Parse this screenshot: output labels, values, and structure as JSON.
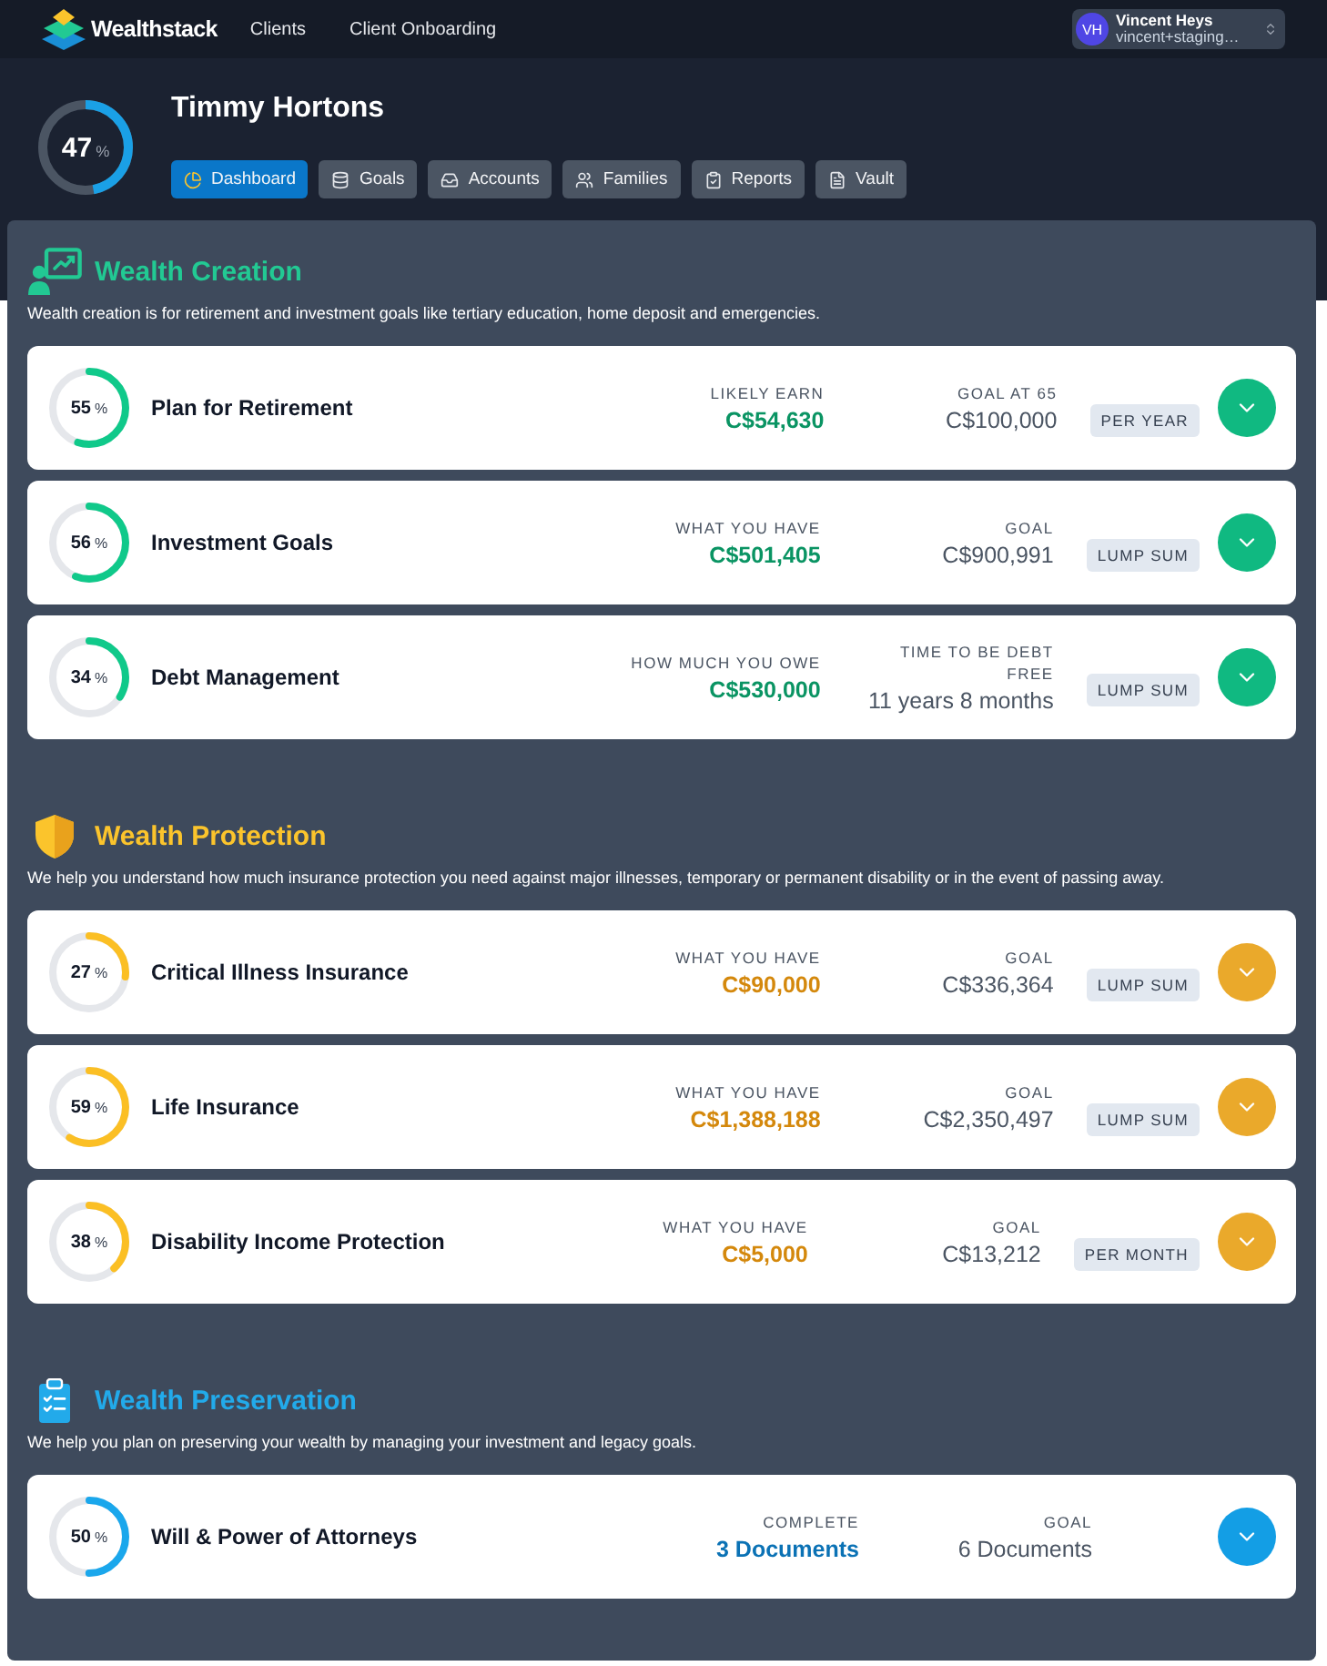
{
  "nav": {
    "brand": "Wealthstack",
    "links": [
      "Clients",
      "Client Onboarding"
    ],
    "user": {
      "initials": "VH",
      "name": "Vincent Heys",
      "email": "vincent+staging…"
    }
  },
  "client": {
    "name": "Timmy Hortons",
    "score": {
      "value": "47",
      "unit": "%",
      "level": 0.47
    }
  },
  "tabs": [
    {
      "label": "Dashboard",
      "selected": true
    },
    {
      "label": "Goals",
      "selected": false
    },
    {
      "label": "Accounts",
      "selected": false
    },
    {
      "label": "Families",
      "selected": false
    },
    {
      "label": "Reports",
      "selected": false
    },
    {
      "label": "Vault",
      "selected": false
    }
  ],
  "sections": [
    {
      "kind": "creation",
      "title": "Wealth Creation",
      "description": "Wealth creation is for retirement and investment goals like tertiary education, home deposit and emergencies.",
      "goals": [
        {
          "title": "Plan for Retirement",
          "progress": {
            "value": "55",
            "unit": "%",
            "level": 0.55
          },
          "current": {
            "label": "LIKELY EARN",
            "value": "C$54,630"
          },
          "target": {
            "label": "GOAL AT 65",
            "value": "C$100,000"
          },
          "badge": "PER YEAR"
        },
        {
          "title": "Investment Goals",
          "progress": {
            "value": "56",
            "unit": "%",
            "level": 0.56
          },
          "current": {
            "label": "WHAT YOU HAVE",
            "value": "C$501,405"
          },
          "target": {
            "label": "GOAL",
            "value": "C$900,991"
          },
          "badge": "LUMP SUM"
        },
        {
          "title": "Debt Management",
          "progress": {
            "value": "34",
            "unit": "%",
            "level": 0.34
          },
          "current": {
            "label": "HOW MUCH YOU OWE",
            "value": "C$530,000"
          },
          "target": {
            "label": "TIME TO BE DEBT FREE",
            "value": "11 years 8 months"
          },
          "badge": "LUMP SUM"
        }
      ]
    },
    {
      "kind": "protection",
      "title": "Wealth Protection",
      "description": "We help you understand how much insurance protection you need against major illnesses, temporary or permanent disability or in the event of passing away.",
      "goals": [
        {
          "title": "Critical Illness Insurance",
          "progress": {
            "value": "27",
            "unit": "%",
            "level": 0.27
          },
          "current": {
            "label": "WHAT YOU HAVE",
            "value": "C$90,000"
          },
          "target": {
            "label": "GOAL",
            "value": "C$336,364"
          },
          "badge": "LUMP SUM"
        },
        {
          "title": "Life Insurance",
          "progress": {
            "value": "59",
            "unit": "%",
            "level": 0.59
          },
          "current": {
            "label": "WHAT YOU HAVE",
            "value": "C$1,388,188"
          },
          "target": {
            "label": "GOAL",
            "value": "C$2,350,497"
          },
          "badge": "LUMP SUM"
        },
        {
          "title": "Disability Income Protection",
          "progress": {
            "value": "38",
            "unit": "%",
            "level": 0.38
          },
          "current": {
            "label": "WHAT YOU HAVE",
            "value": "C$5,000"
          },
          "target": {
            "label": "GOAL",
            "value": "C$13,212"
          },
          "badge": "PER MONTH"
        }
      ]
    },
    {
      "kind": "preservation",
      "title": "Wealth Preservation",
      "description": "We help you plan on preserving your wealth by managing your investment and legacy goals.",
      "goals": [
        {
          "title": "Will & Power of Attorneys",
          "progress": {
            "value": "50",
            "unit": "%",
            "level": 0.5
          },
          "current": {
            "label": "COMPLETE",
            "value": "3 Documents"
          },
          "target": {
            "label": "GOAL",
            "value": "6 Documents"
          }
        }
      ]
    }
  ]
}
